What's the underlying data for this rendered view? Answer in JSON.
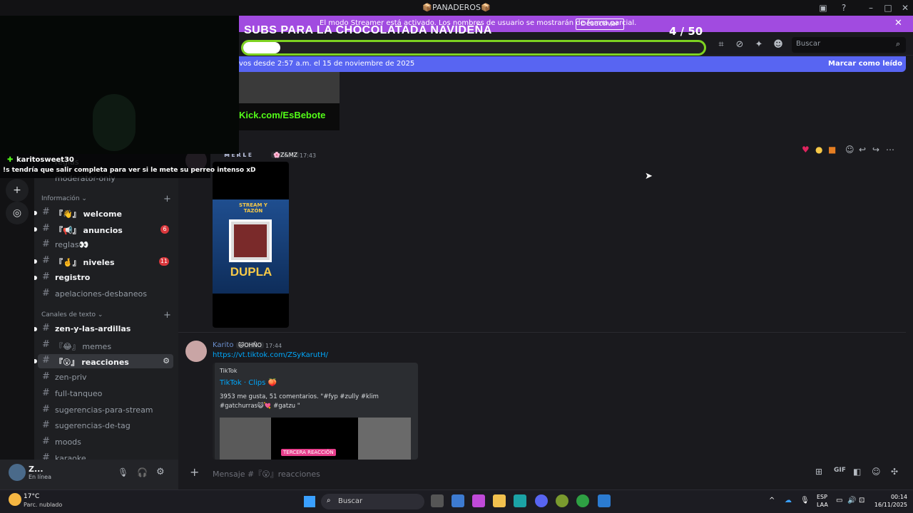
{
  "window": {
    "title": "📦PANADEROS📦"
  },
  "streamer_banner": {
    "text": "El modo Streamer está activado. Los nombres de usuario se mostrarán de forma parcial.",
    "button": "Desactivar"
  },
  "overlay": {
    "title": "SUBS PARA LA CHOCOLATADA NAVIDEÑA",
    "count": "4  / 50",
    "progress": 0.08
  },
  "chat_popup": {
    "user": "karitosweet30",
    "message": "!s tendría que salir completa para ver si le mete su perreo intenso xD"
  },
  "new_messages_bar": {
    "text": "vos desde 2:57 a.m. el 15 de noviembre de 2025",
    "action": "Marcar como leído"
  },
  "search": {
    "placeholder": "Buscar"
  },
  "sidebar": {
    "partial_top": [
      "reglas",
      "moderator-only"
    ],
    "categories": [
      {
        "name": "Información",
        "channels": [
          {
            "name": "welcome",
            "prefix": "『👋』",
            "bold": true
          },
          {
            "name": "anuncios",
            "prefix": "『📢』",
            "bold": true,
            "badge": "6"
          },
          {
            "name": "reglas👀",
            "prefix": "",
            "bold": false
          },
          {
            "name": "niveles",
            "prefix": "『🤞』",
            "bold": true,
            "badge": "11"
          },
          {
            "name": "registro",
            "prefix": "",
            "bold": true
          },
          {
            "name": "apelaciones-desbaneos",
            "prefix": "",
            "bold": false
          }
        ]
      },
      {
        "name": "Canales de texto",
        "channels": [
          {
            "name": "zen-y-las-ardillas",
            "prefix": "",
            "bold": true
          },
          {
            "name": "memes",
            "prefix": "『😂』",
            "bold": false
          },
          {
            "name": "reacciones",
            "prefix": "『😮』",
            "bold": true,
            "active": true
          },
          {
            "name": "zen-priv",
            "prefix": "",
            "bold": false
          },
          {
            "name": "full-tanqueo",
            "prefix": "",
            "bold": false
          },
          {
            "name": "sugerencias-para-stream",
            "prefix": "",
            "bold": false
          },
          {
            "name": "sugerencias-de-tag",
            "prefix": "",
            "bold": false
          },
          {
            "name": "moods",
            "prefix": "",
            "bold": false
          },
          {
            "name": "karaoke",
            "prefix": "",
            "bold": false
          }
        ]
      }
    ]
  },
  "user_panel": {
    "name": "Z...",
    "status": "En línea"
  },
  "messages": [
    {
      "author": "ᴍᴇʀʟᴇ",
      "tag": "Z&MZ",
      "time": "17:43",
      "image_caption": "Kick.com/EsBebote",
      "poster_title": "DUPLA",
      "poster_top": "STREAM Y TAZÓN"
    },
    {
      "author": "Karito",
      "tag": "OHÑO",
      "time": "17:44",
      "link": "https://vt.tiktok.com/ZSyKarutH/",
      "embed": {
        "provider": "TikTok",
        "title": "TikTok · Clips 🍑",
        "description": "3953 me gusta, 51 comentarios. \"#fyp #zully #klim #gatchurras😺💘 #gatzu \"",
        "thumb_label": "TERCERA REACCIÓN"
      }
    }
  ],
  "composer": {
    "placeholder": "Mensaje #『😮』reacciones"
  },
  "taskbar": {
    "weather_temp": "17°C",
    "weather_desc": "Parc. nublado",
    "search": "Buscar",
    "lang": "ESP",
    "lang2": "LAA",
    "time": "00:14",
    "date": "16/11/2025"
  }
}
